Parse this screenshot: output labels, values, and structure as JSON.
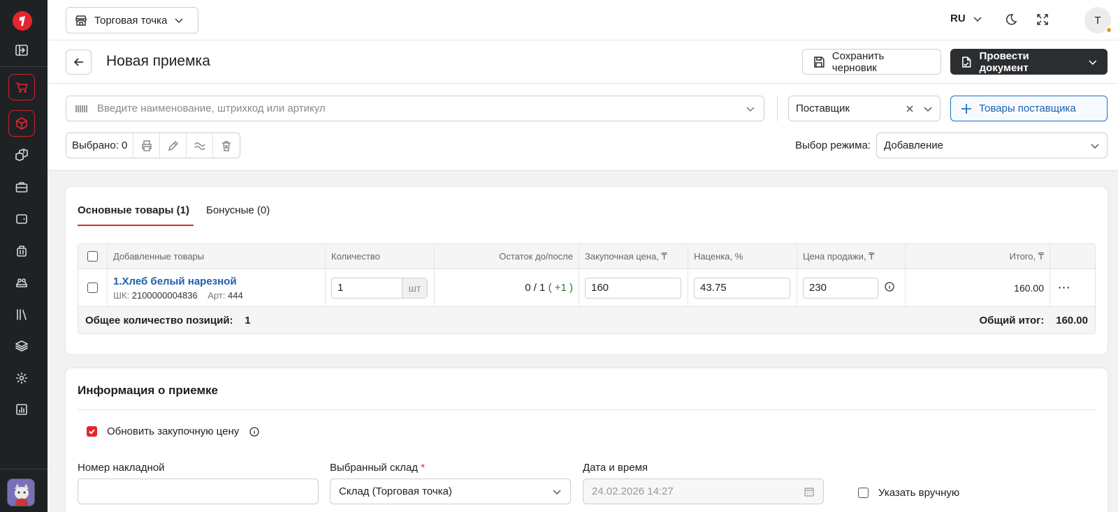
{
  "topbar": {
    "store": "Торговая точка",
    "lang": "RU",
    "user_initial": "T"
  },
  "header": {
    "title": "Новая приемка",
    "save_draft": "Сохранить черновик",
    "post_document": "Провести документ"
  },
  "toolbar": {
    "search_placeholder": "Введите наименование, штрихкод или артикул",
    "supplier_value": "Поставщик",
    "supplier_goods": "Товары поставщика",
    "selected": "Выбрано: 0",
    "mode_label": "Выбор режима:",
    "mode_value": "Добавление"
  },
  "tabs": {
    "main": "Основные товары (1)",
    "bonus": "Бонусные (0)"
  },
  "table": {
    "columns": {
      "added": "Добавленные товары",
      "qty": "Количество",
      "rest": "Остаток до/после",
      "buy": "Закупочная цена, ₸",
      "markup": "Наценка, %",
      "sell": "Цена продажи, ₸",
      "total": "Итого, ₸"
    },
    "rows": [
      {
        "name": "1.Хлеб белый нарезной",
        "barcode_label": "ШК:",
        "barcode": "2100000004836",
        "article_label": "Арт:",
        "article": "444",
        "qty": "1",
        "unit": "шт",
        "rest_before": "0 / 1",
        "rest_delta": "( +1 )",
        "buy": "160",
        "markup": "43.75",
        "sell": "230",
        "total": "160.00"
      }
    ],
    "footer": {
      "positions_label": "Общее количество позиций:",
      "positions_value": "1",
      "grand_label": "Общий итог:",
      "grand_value": "160.00"
    }
  },
  "info": {
    "title": "Информация о приемке",
    "update_price": "Обновить закупочную цену",
    "invoice_label": "Номер накладной",
    "invoice_value": "",
    "warehouse_label": "Выбранный склад",
    "warehouse_required": "*",
    "warehouse_value": "Склад (Торговая точка)",
    "datetime_label": "Дата и время",
    "datetime_value": "24.02.2026 14:27",
    "manual_label": "Указать вручную"
  }
}
